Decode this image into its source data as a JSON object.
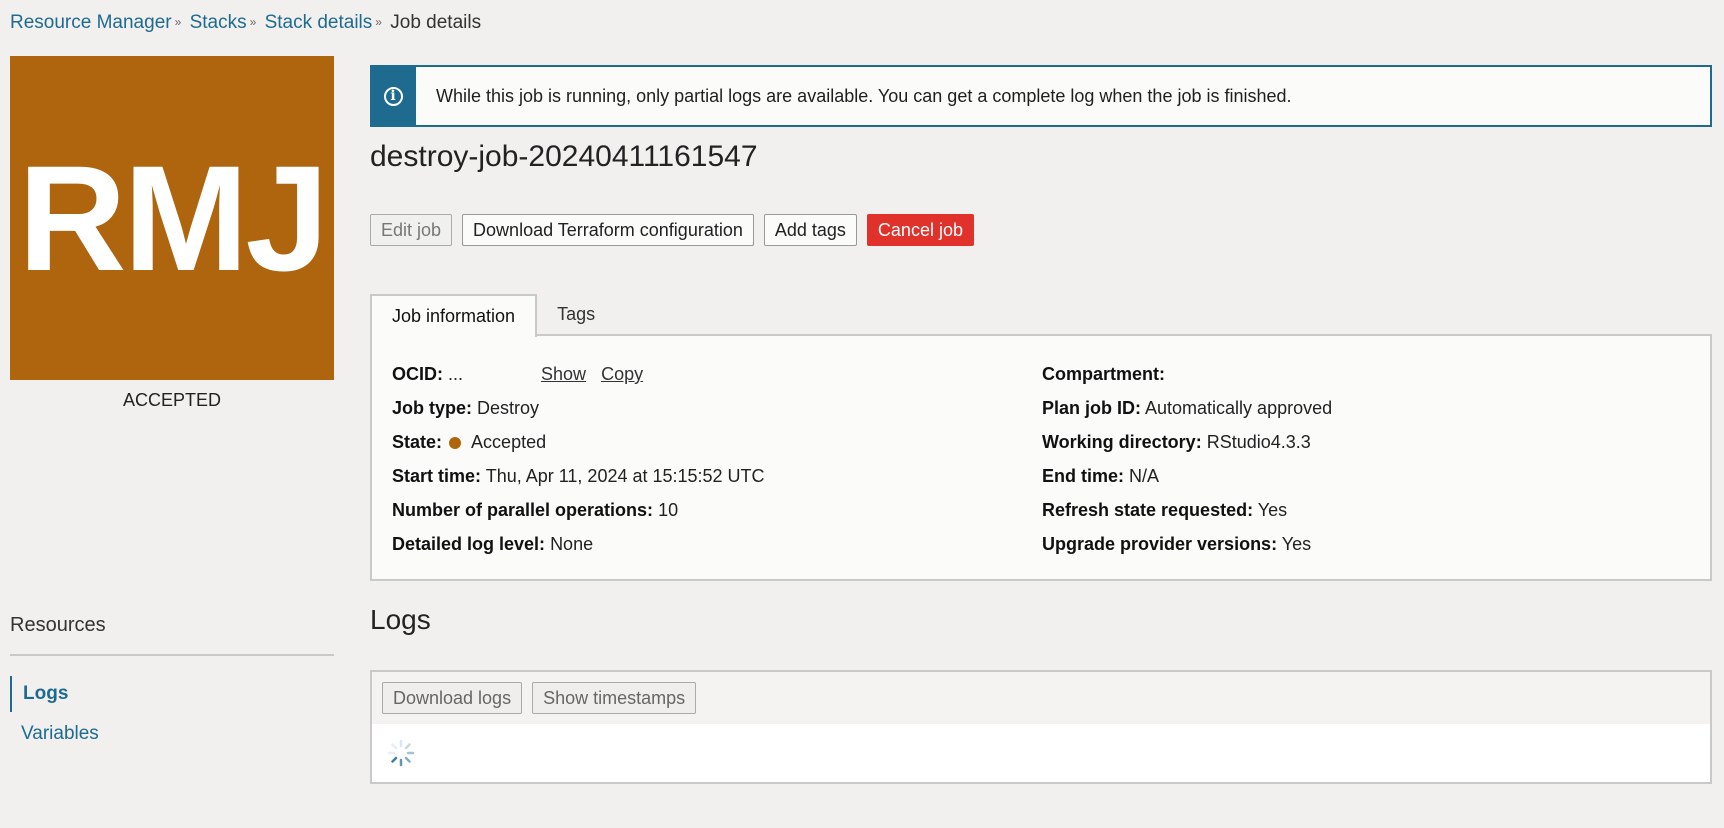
{
  "breadcrumb": {
    "items": [
      "Resource Manager",
      "Stacks",
      "Stack details"
    ],
    "current": "Job details",
    "separator": "»"
  },
  "avatar": {
    "initials": "RMJ",
    "state": "ACCEPTED",
    "color": "#ae650d"
  },
  "resources": {
    "heading": "Resources",
    "items": [
      "Logs",
      "Variables"
    ]
  },
  "alert": {
    "icon": "info-icon",
    "text": "While this job is running, only partial logs are available. You can get a complete log when the job is finished."
  },
  "job": {
    "title": "destroy-job-20240411161547"
  },
  "actions": {
    "edit": "Edit job",
    "download_tf": "Download Terraform configuration",
    "add_tags": "Add tags",
    "cancel": "Cancel job"
  },
  "tabs": [
    "Job information",
    "Tags"
  ],
  "info": {
    "ocid_label": "OCID:",
    "ocid_value": "...",
    "show": "Show",
    "copy": "Copy",
    "job_type_label": "Job type:",
    "job_type": "Destroy",
    "state_label": "State:",
    "state": "Accepted",
    "start_time_label": "Start time:",
    "start_time": "Thu, Apr 11, 2024 at 15:15:52 UTC",
    "parallel_label": "Number of parallel operations:",
    "parallel": "10",
    "log_level_label": "Detailed log level:",
    "log_level": "None",
    "compartment_label": "Compartment:",
    "plan_job_label": "Plan job ID:",
    "plan_job": "Automatically approved",
    "workdir_label": "Working directory:",
    "workdir": "RStudio4.3.3",
    "end_time_label": "End time:",
    "end_time": "N/A",
    "refresh_label": "Refresh state requested:",
    "refresh": "Yes",
    "upgrade_label": "Upgrade provider versions:",
    "upgrade": "Yes"
  },
  "logs": {
    "title": "Logs",
    "download": "Download logs",
    "timestamps": "Show timestamps"
  }
}
